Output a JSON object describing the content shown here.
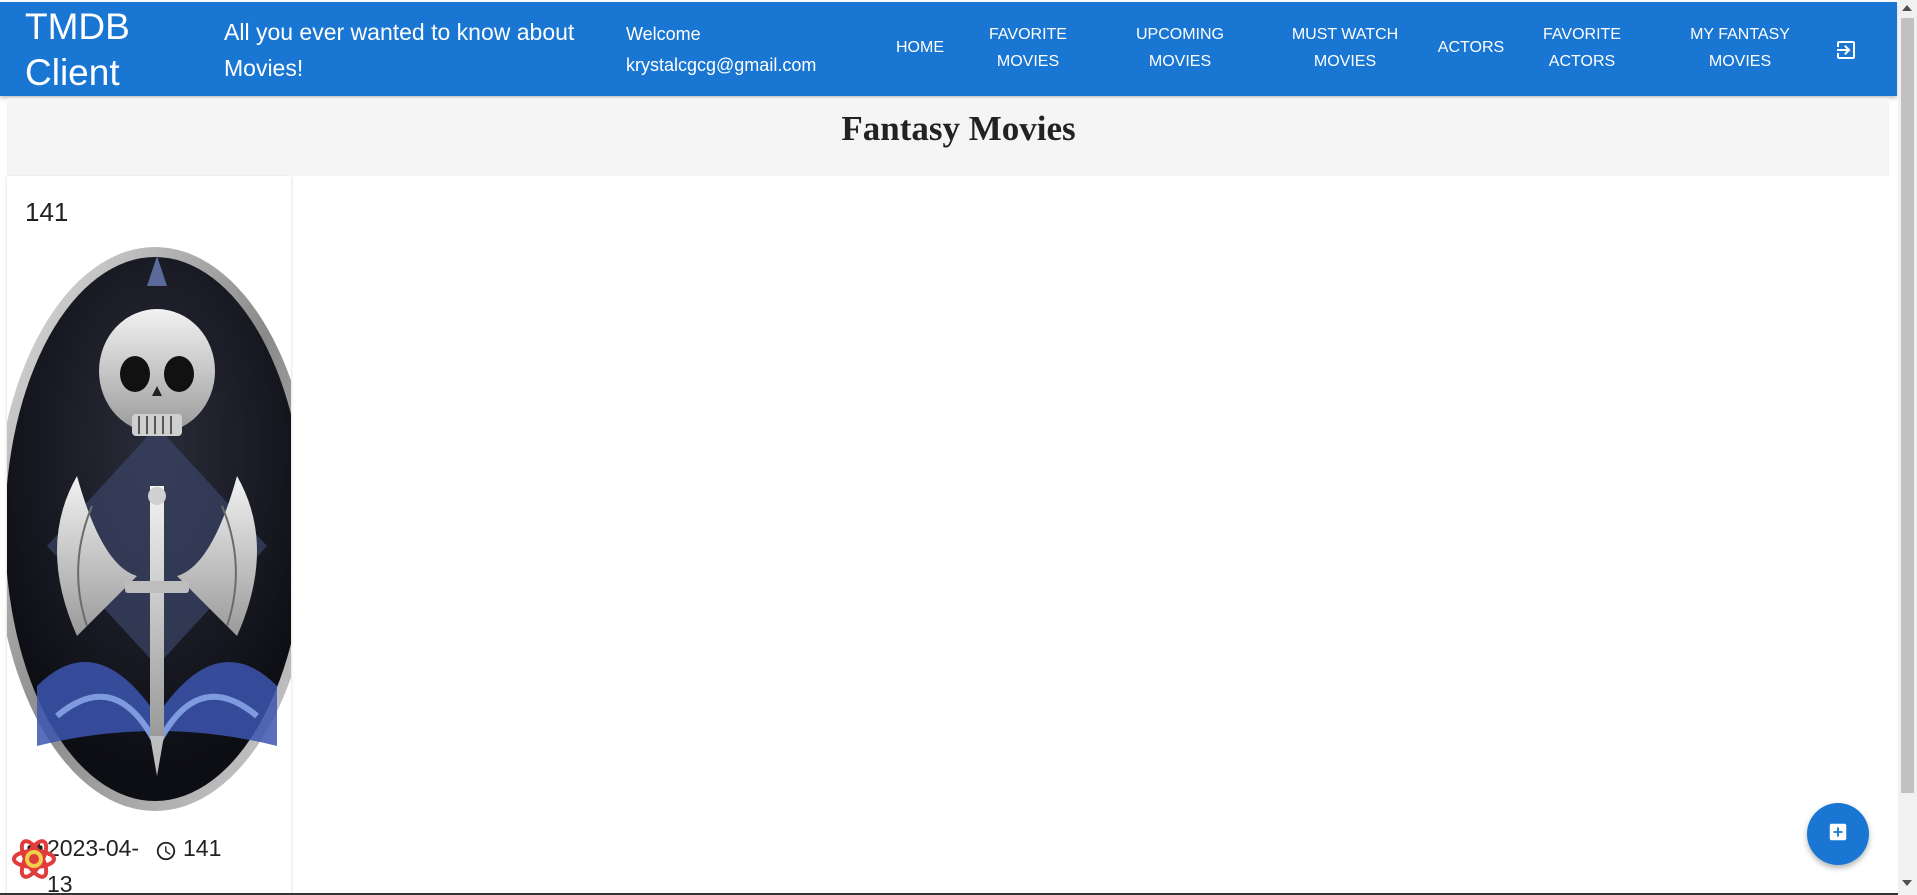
{
  "header": {
    "brand": "TMDB Client",
    "tagline": "All you ever wanted to know about Movies!",
    "welcome_label": "Welcome",
    "user_email": "krystalcgcg@gmail.com",
    "nav": [
      {
        "line1": "HOME",
        "line2": ""
      },
      {
        "line1": "FAVORITE",
        "line2": "MOVIES"
      },
      {
        "line1": "UPCOMING",
        "line2": "MOVIES"
      },
      {
        "line1": "MUST WATCH",
        "line2": "MOVIES"
      },
      {
        "line1": "ACTORS",
        "line2": ""
      },
      {
        "line1": "FAVORITE",
        "line2": "ACTORS"
      },
      {
        "line1": "MY FANTASY",
        "line2": "MOVIES"
      }
    ],
    "logout_icon": "logout-icon",
    "bar_color": "#1976d2"
  },
  "page": {
    "title": "Fantasy Movies"
  },
  "movies": [
    {
      "title": "141",
      "release_date": "2023-04-13",
      "runtime": "141",
      "poster_icon": "skull-winged-dagger-emblem"
    }
  ],
  "fab": {
    "icon": "add-box-icon"
  }
}
